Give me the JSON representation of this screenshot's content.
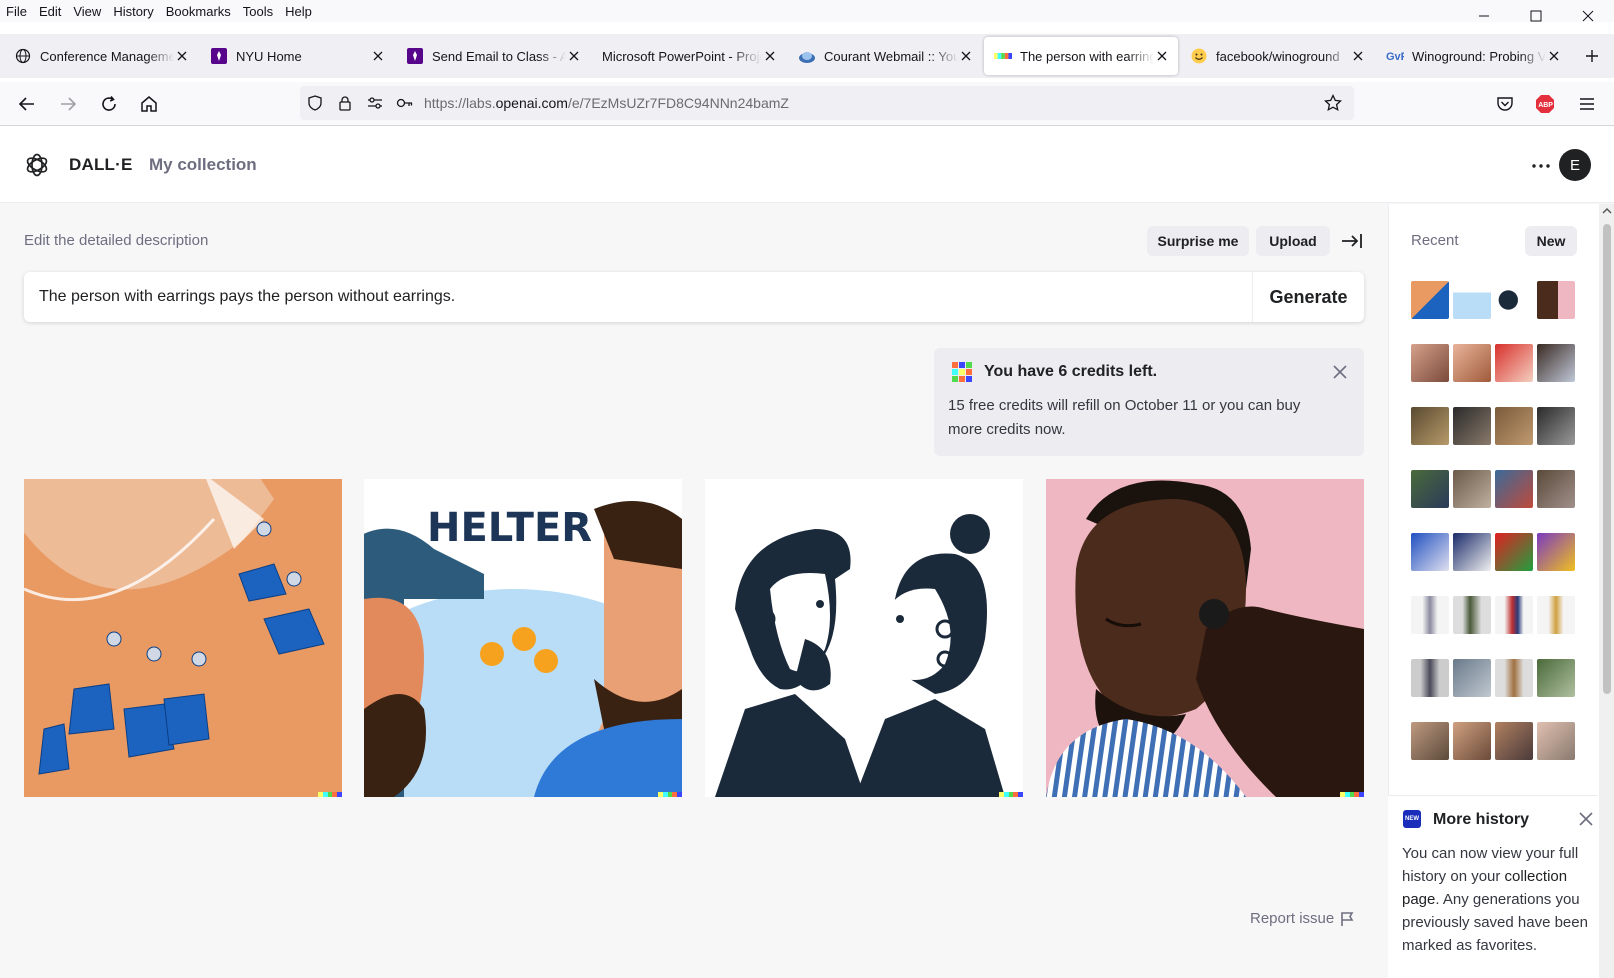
{
  "menubar": {
    "items": [
      "File",
      "Edit",
      "View",
      "History",
      "Bookmarks",
      "Tools",
      "Help"
    ]
  },
  "tabs": [
    {
      "title": "Conference Management Toolkit",
      "icon": "globe-icon",
      "active": false
    },
    {
      "title": "NYU Home",
      "icon": "nyu-torch-icon",
      "active": false
    },
    {
      "title": "Send Email to Class - Albert",
      "icon": "nyu-torch-icon",
      "active": false
    },
    {
      "title": "Microsoft PowerPoint - Project",
      "icon": "none",
      "active": false
    },
    {
      "title": "Courant Webmail :: Your",
      "icon": "webmail-icon",
      "active": false
    },
    {
      "title": "The person with earrings",
      "icon": "dalle-color-bar-icon",
      "active": true
    },
    {
      "title": "facebook/winoground",
      "icon": "huggingface-icon",
      "active": false
    },
    {
      "title": "Winoground: Probing Vision",
      "icon": "gvf-icon",
      "active": false
    }
  ],
  "url": {
    "prefix": "https://labs.",
    "domain": "openai.com",
    "path": "/e/7EzMsUZr7FD8C94NNn24bamZ"
  },
  "header": {
    "brand": "DALL·E",
    "collection_link": "My collection",
    "avatar_initial": "E"
  },
  "editor": {
    "label": "Edit the detailed description",
    "surprise_label": "Surprise me",
    "upload_label": "Upload",
    "prompt_value": "The person with earrings pays the person without earrings.",
    "generate_label": "Generate"
  },
  "credits": {
    "title": "You have 6 credits left.",
    "body": "15 free credits will refill on October 11 or you can buy more credits now."
  },
  "images": [
    {
      "name": "blue-glass-earrings-image"
    },
    {
      "name": "helter-cartoon-two-men-image"
    },
    {
      "name": "two-faces-illustration-image",
      "caption": ""
    },
    {
      "name": "man-earbud-photo-image"
    }
  ],
  "hiddenWatermark": [
    "#ffff66",
    "#42ffff",
    "#51da4c",
    "#ff6e3c",
    "#3c46ff"
  ],
  "report_label": "Report issue",
  "sidebar": {
    "recent_label": "Recent",
    "new_label": "New"
  },
  "more_history": {
    "title": "More history",
    "body_pre": "You can now view your full history on your ",
    "link": "collection page",
    "body_post": ". Any generations you previously saved have been marked as favorites."
  },
  "colors": {
    "accent": "#202123",
    "muted": "#6e6e80",
    "panel": "#ececf1",
    "new_badge": "#1a2dba"
  }
}
